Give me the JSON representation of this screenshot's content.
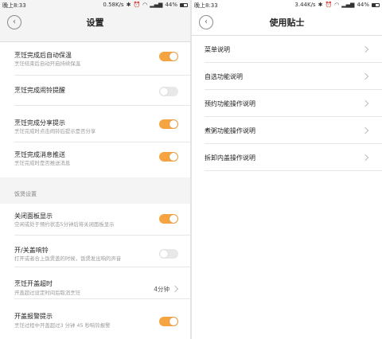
{
  "left": {
    "status": {
      "time": "晚上8:33",
      "speed": "0.58K/s",
      "battery": "44%"
    },
    "title": "设置",
    "settings": [
      {
        "title": "烹饪完成后自动保温",
        "subtitle": "烹饪结束后自动开启持续保温",
        "toggle": "on"
      },
      {
        "title": "烹饪完成闹铃提醒",
        "subtitle": "",
        "toggle": "off"
      },
      {
        "title": "烹饪完成分享提示",
        "subtitle": "烹饪完成时点击闹铃后提示是否分享",
        "toggle": "on"
      },
      {
        "title": "烹饪完成消息推送",
        "subtitle": "烹饪完成时是否推送消息",
        "toggle": "on"
      }
    ],
    "group_label": "饭煲设置",
    "device_settings": [
      {
        "title": "关闭面板显示",
        "subtitle": "空闲或处于预约状态5分钟后将关闭面板显示",
        "toggle": "on"
      },
      {
        "title": "开/关盖响铃",
        "subtitle": "打开或者合上饭煲盖的时候，饭煲发出响的声音",
        "toggle": "off"
      },
      {
        "title": "烹饪开盖超时",
        "subtitle": "开盖超过设定时间后取消烹饪",
        "value": "4分钟"
      },
      {
        "title": "开盖报警提示",
        "subtitle": "烹饪过程中开盖超过3 分钟 45 秒响铃报警",
        "toggle": "on"
      }
    ]
  },
  "right": {
    "status": {
      "time": "晚上8:33",
      "speed": "3.44K/s",
      "battery": "44%"
    },
    "title": "使用贴士",
    "tips": [
      "菜单说明",
      "自选功能说明",
      "预约功能操作说明",
      "煮粥功能操作说明",
      "拆卸内盖操作说明"
    ]
  },
  "colors": {
    "accent": "#f5a441",
    "toggle_off": "#e8e8e8"
  },
  "icons": [
    "back-arrow-icon",
    "chevron-right-icon",
    "bluetooth-icon",
    "alarm-icon",
    "wifi-icon",
    "signal-icon",
    "battery-icon"
  ]
}
